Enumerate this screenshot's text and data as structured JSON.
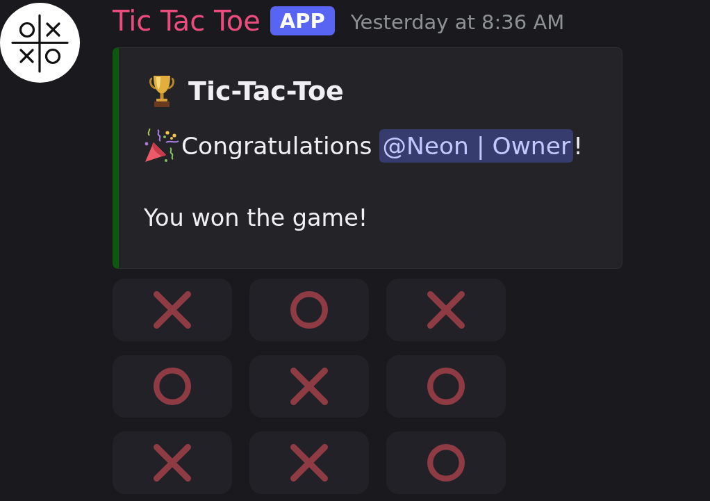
{
  "message": {
    "author": "Tic Tac Toe",
    "badge": "APP",
    "timestamp": "Yesterday at 8:36 AM",
    "embed": {
      "title": "Tic-Tac-Toe",
      "congrats_text": "Congratulations",
      "mention": "@Neon | Owner",
      "congrats_end": "!",
      "result": "You won the game!"
    },
    "board": [
      [
        {
          "kind": "x",
          "disabled": true
        },
        {
          "kind": "o",
          "disabled": true
        },
        {
          "kind": "x",
          "disabled": true
        }
      ],
      [
        {
          "kind": "o",
          "disabled": true
        },
        {
          "kind": "x",
          "disabled": true
        },
        {
          "kind": "o",
          "disabled": true
        }
      ],
      [
        {
          "kind": "x",
          "disabled": true
        },
        {
          "kind": "x",
          "disabled": true
        },
        {
          "kind": "o",
          "disabled": true
        }
      ]
    ]
  }
}
